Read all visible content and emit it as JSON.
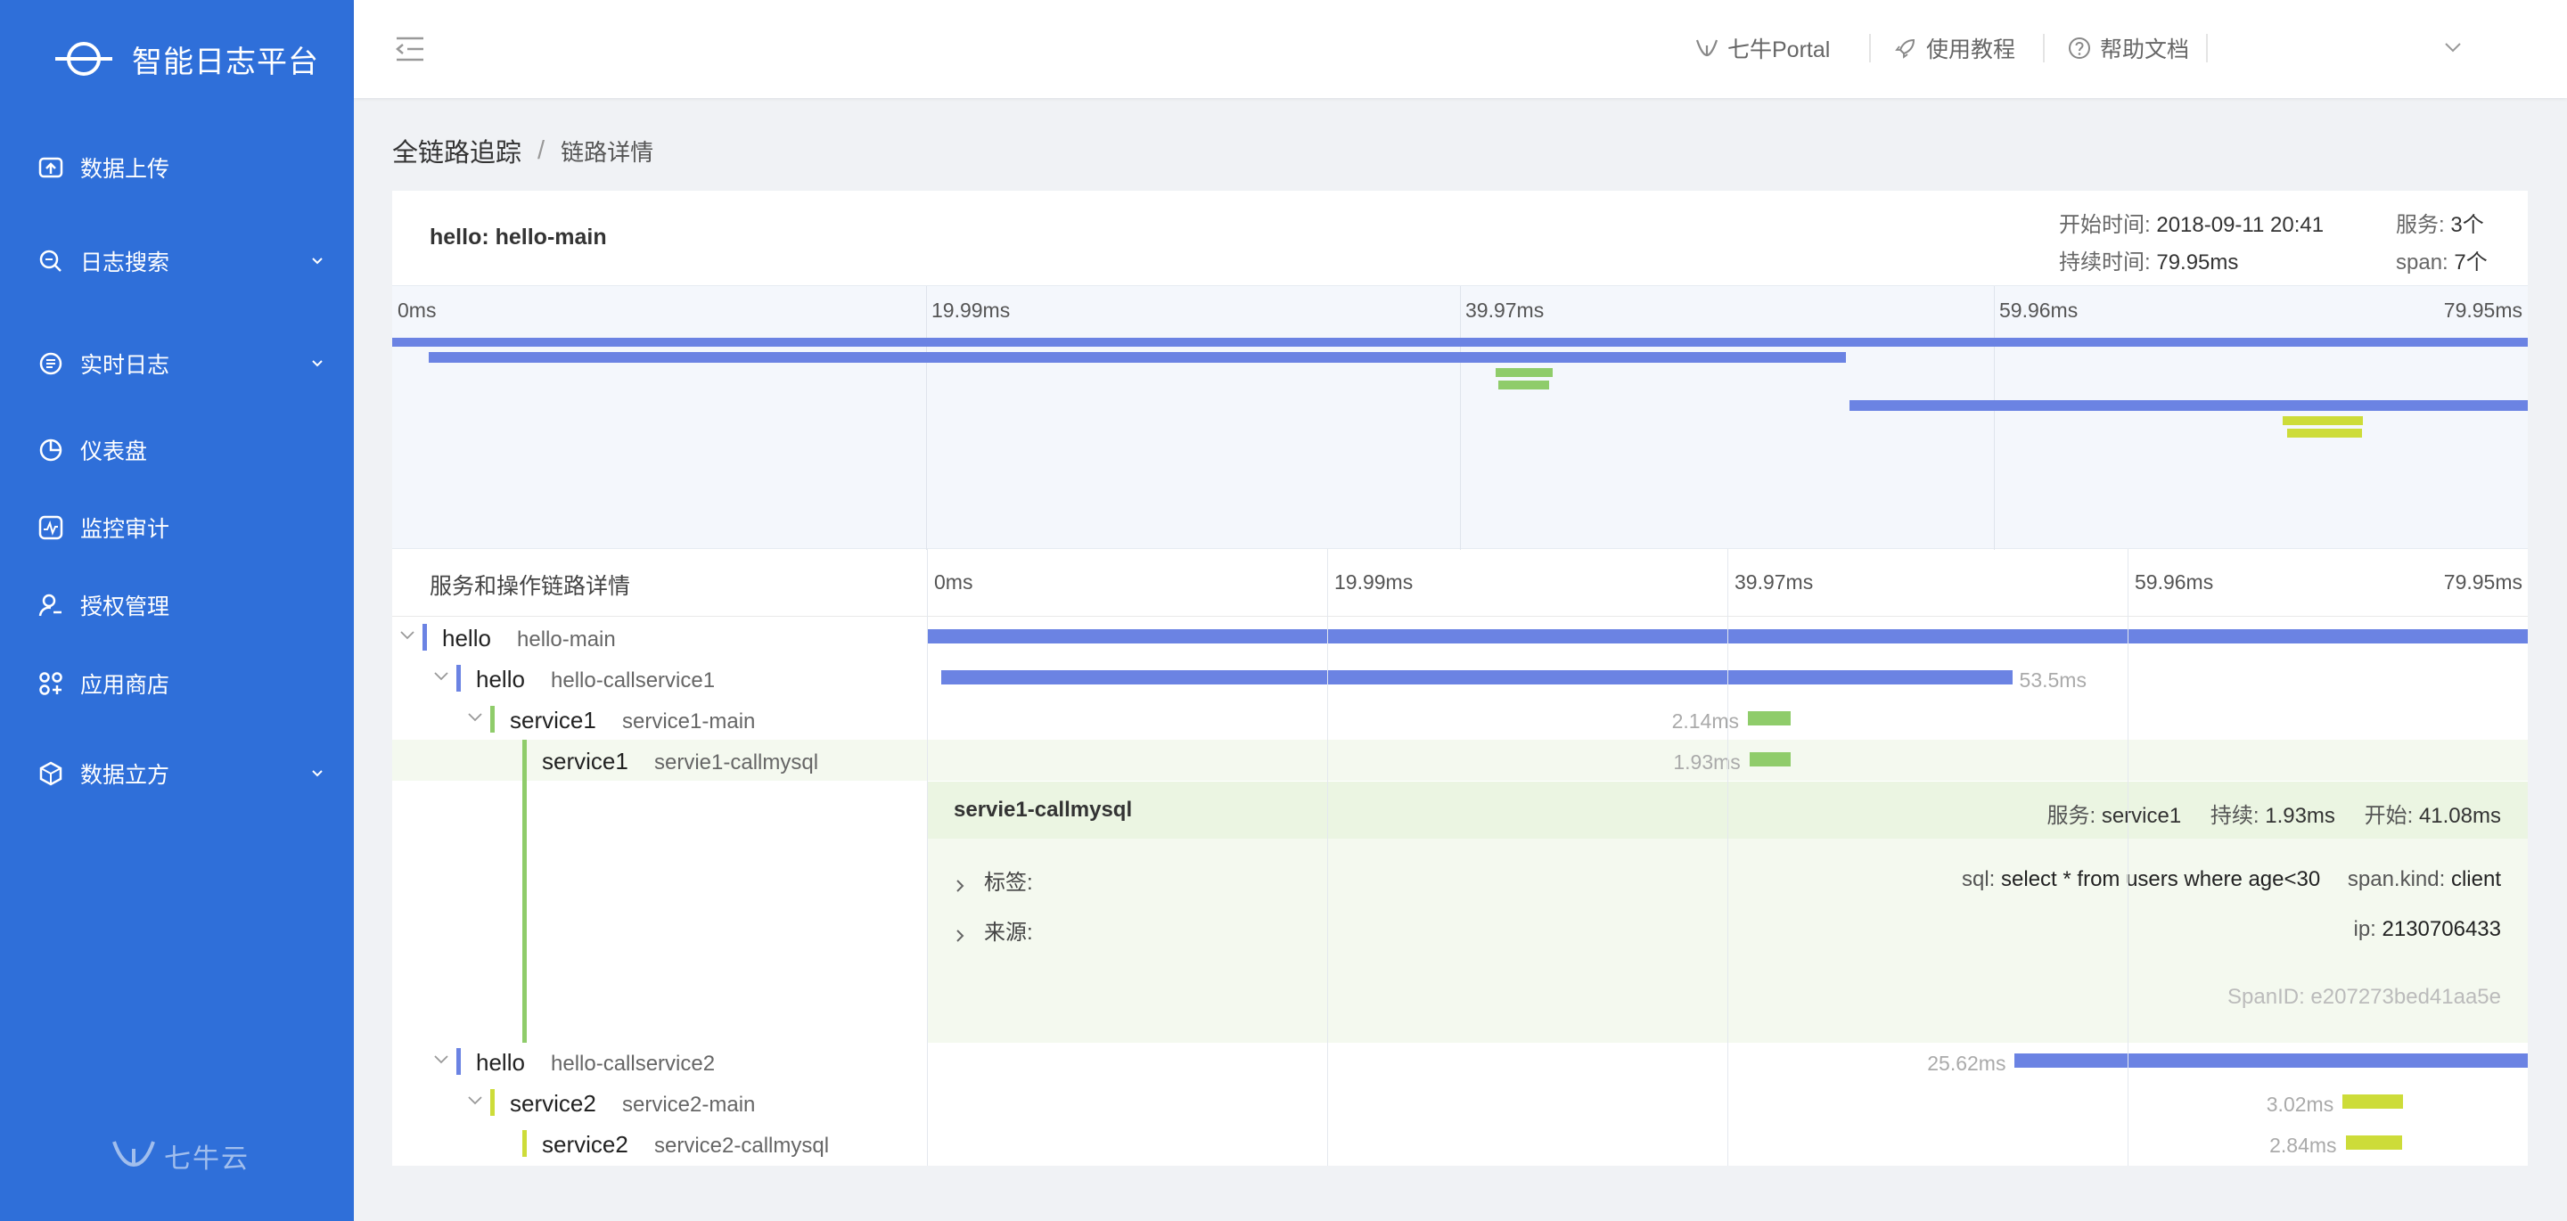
{
  "app": {
    "title": "智能日志平台",
    "footer_brand": "七牛云"
  },
  "sidebar": {
    "items": [
      {
        "label": "数据上传",
        "icon": "upload-icon",
        "has_children": false
      },
      {
        "label": "日志搜索",
        "icon": "search-log-icon",
        "has_children": true
      },
      {
        "label": "实时日志",
        "icon": "realtime-log-icon",
        "has_children": true
      },
      {
        "label": "仪表盘",
        "icon": "dashboard-icon",
        "has_children": false
      },
      {
        "label": "监控审计",
        "icon": "monitor-icon",
        "has_children": false
      },
      {
        "label": "授权管理",
        "icon": "user-auth-icon",
        "has_children": false
      },
      {
        "label": "应用商店",
        "icon": "app-store-icon",
        "has_children": false
      },
      {
        "label": "数据立方",
        "icon": "data-cube-icon",
        "has_children": true
      }
    ]
  },
  "header": {
    "links": [
      {
        "label": "七牛Portal",
        "icon": "qiniu-icon"
      },
      {
        "label": "使用教程",
        "icon": "rocket-icon"
      },
      {
        "label": "帮助文档",
        "icon": "help-icon"
      }
    ]
  },
  "breadcrumb": {
    "parent": "全链路追踪",
    "separator": "/",
    "current": "链路详情"
  },
  "trace": {
    "name": "hello: hello-main",
    "start_label": "开始时间:",
    "start_value": "2018-09-11 20:41",
    "duration_label": "持续时间:",
    "duration_value": "79.95ms",
    "services_label": "服务:",
    "services_value": "3个",
    "span_label": "span:",
    "span_value": "7个",
    "total_ms": 79.95
  },
  "timeline": {
    "ticks": [
      "0ms",
      "19.99ms",
      "39.97ms",
      "59.96ms",
      "79.95ms"
    ]
  },
  "detail": {
    "header_label": "服务和操作链路详情",
    "spans": [
      {
        "service": "hello",
        "operation": "hello-main",
        "start": 0,
        "duration": 79.95,
        "color": "#6b83e3",
        "depth": 0,
        "toggle": "down",
        "duration_label": ""
      },
      {
        "service": "hello",
        "operation": "hello-callservice1",
        "start": 0.7,
        "duration": 53.5,
        "color": "#6b83e3",
        "depth": 1,
        "toggle": "down",
        "duration_label": "53.5ms"
      },
      {
        "service": "service1",
        "operation": "service1-main",
        "start": 41.0,
        "duration": 2.14,
        "color": "#8fcc6a",
        "depth": 2,
        "toggle": "down",
        "duration_label": "2.14ms"
      },
      {
        "service": "service1",
        "operation": "servie1-callmysql",
        "start": 41.08,
        "duration": 1.93,
        "color": "#8fcc6a",
        "depth": 3,
        "toggle": "none",
        "duration_label": "1.93ms"
      },
      {
        "service": "hello",
        "operation": "hello-callservice2",
        "start": 54.33,
        "duration": 25.62,
        "color": "#6b83e3",
        "depth": 1,
        "toggle": "down",
        "duration_label": "25.62ms"
      },
      {
        "service": "service2",
        "operation": "service2-main",
        "start": 70.7,
        "duration": 3.02,
        "color": "#cddc39",
        "depth": 2,
        "toggle": "down",
        "duration_label": "3.02ms"
      },
      {
        "service": "service2",
        "operation": "service2-callmysql",
        "start": 70.85,
        "duration": 2.84,
        "color": "#cddc39",
        "depth": 3,
        "toggle": "none",
        "duration_label": "2.84ms"
      }
    ],
    "expanded": {
      "title": "servie1-callmysql",
      "service_label": "服务:",
      "service_value": "service1",
      "duration_label": "持续:",
      "duration_value": "1.93ms",
      "start_label": "开始:",
      "start_value": "41.08ms",
      "tags_label": "标签:",
      "tags": [
        {
          "key": "sql:",
          "value": "select * from users where age<30"
        },
        {
          "key": "span.kind:",
          "value": "client"
        }
      ],
      "process_label": "来源:",
      "process": [
        {
          "key": "ip:",
          "value": "2130706433"
        }
      ],
      "span_id": "SpanID: e207273bed41aa5e"
    }
  },
  "colors": {
    "sidebar": "#2f6fd9",
    "hello": "#6b83e3",
    "service1": "#8fcc6a",
    "service2": "#cddc39"
  }
}
